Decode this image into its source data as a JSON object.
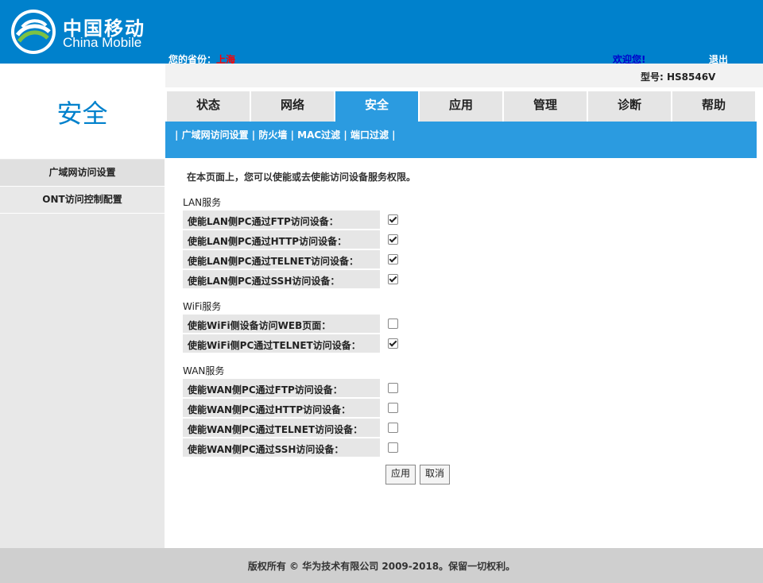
{
  "header": {
    "brand_cn": "中国移动",
    "brand_en": "China Mobile",
    "province_label": "您的省份：",
    "province_value": "上海",
    "welcome": "欢迎您!",
    "logout": "退出",
    "colors": {
      "header_bg": "#0081cc",
      "accent": "#2b9be0"
    }
  },
  "sidebar": {
    "section_title": "安全",
    "items": [
      {
        "label": "广域网访问设置"
      },
      {
        "label": "ONT访问控制配置"
      }
    ]
  },
  "model": "型号: HS8546V",
  "tabs": [
    {
      "label": "状态"
    },
    {
      "label": "网络"
    },
    {
      "label": "安全",
      "active": true
    },
    {
      "label": "应用"
    },
    {
      "label": "管理"
    },
    {
      "label": "诊断"
    },
    {
      "label": "帮助"
    }
  ],
  "subnav": {
    "sep": "|",
    "items": [
      "广域网访问设置",
      "防火墙",
      "MAC过滤",
      "端口过滤"
    ]
  },
  "intro": "在本页面上，您可以使能或去使能访问设备服务权限。",
  "groups": [
    {
      "label": "LAN服务",
      "rows": [
        {
          "label": "使能LAN侧PC通过FTP访问设备：",
          "checked": true
        },
        {
          "label": "使能LAN侧PC通过HTTP访问设备：",
          "checked": true
        },
        {
          "label": "使能LAN侧PC通过TELNET访问设备：",
          "checked": true
        },
        {
          "label": "使能LAN侧PC通过SSH访问设备：",
          "checked": true
        }
      ]
    },
    {
      "label": "WiFi服务",
      "rows": [
        {
          "label": "使能WiFi侧设备访问WEB页面：",
          "checked": false
        },
        {
          "label": "使能WiFi侧PC通过TELNET访问设备：",
          "checked": true
        }
      ]
    },
    {
      "label": "WAN服务",
      "rows": [
        {
          "label": "使能WAN侧PC通过FTP访问设备：",
          "checked": false
        },
        {
          "label": "使能WAN侧PC通过HTTP访问设备：",
          "checked": false
        },
        {
          "label": "使能WAN侧PC通过TELNET访问设备：",
          "checked": false
        },
        {
          "label": "使能WAN侧PC通过SSH访问设备：",
          "checked": false
        }
      ]
    }
  ],
  "buttons": {
    "apply": "应用",
    "cancel": "取消"
  },
  "footer": "版权所有 © 华为技术有限公司 2009-2018。保留一切权利。"
}
